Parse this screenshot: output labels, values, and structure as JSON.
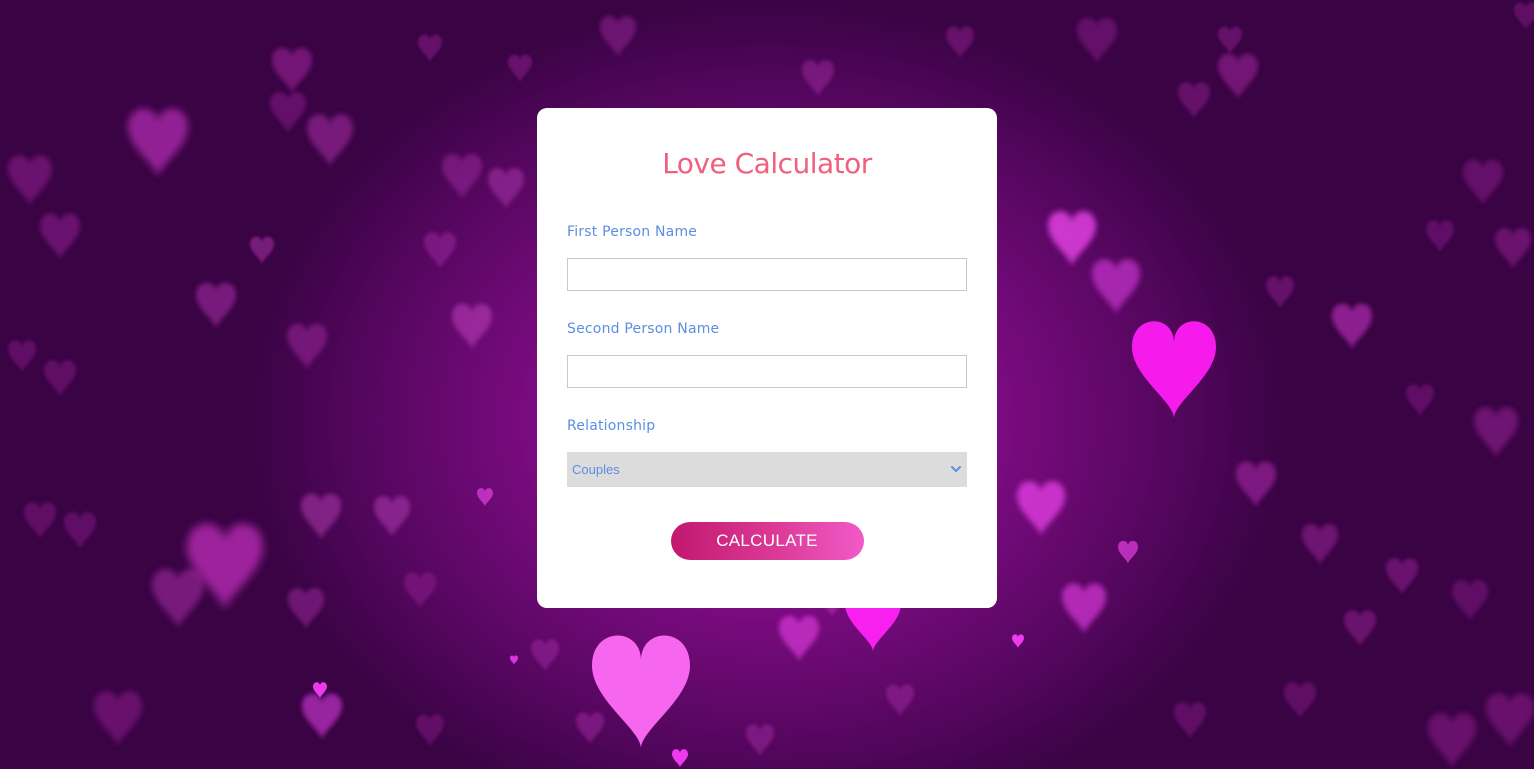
{
  "app": {
    "title": "Love Calculator"
  },
  "form": {
    "first_label": "First Person Name",
    "first_value": "",
    "second_label": "Second Person Name",
    "second_value": "",
    "relationship_label": "Relationship",
    "relationship_selected": "Couples",
    "submit_label": "CALCULATE"
  },
  "colors": {
    "title": "#f0607e",
    "label": "#5b8fe0",
    "background": "#7a0b80",
    "button_start": "#c2186e",
    "button_end": "#f25ac9",
    "heart_bright": "#ff2cf0"
  },
  "icons": {
    "select_arrow": "chevron-down-icon",
    "background": "heart-icon"
  }
}
